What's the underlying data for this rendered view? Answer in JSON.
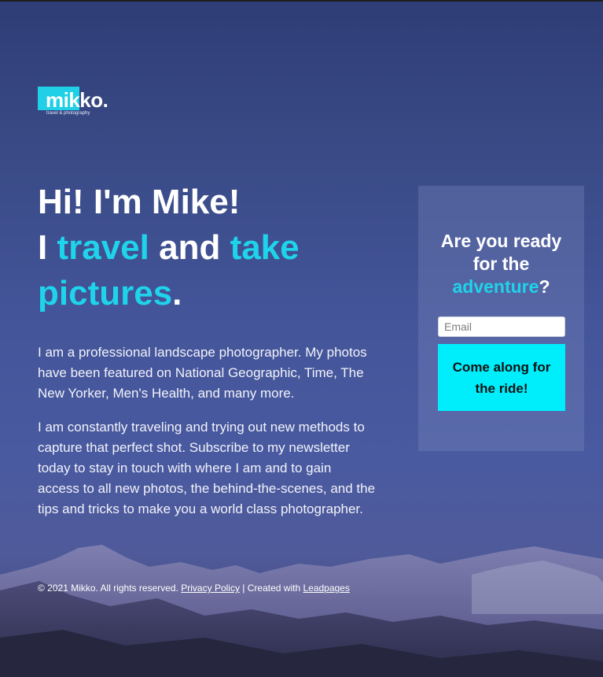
{
  "logo": {
    "name": "mikko.",
    "tagline": "travel & photography",
    "accent_color": "#1fd0e6"
  },
  "headline": {
    "line1": "Hi! I'm Mike!",
    "line2_prefix": "I ",
    "line2_word1": "travel",
    "line2_mid": " and ",
    "line2_word2": "take",
    "line3_word": "pictures",
    "line3_end": ".",
    "highlight_color": "#1fd3ea"
  },
  "bio": {
    "paragraph1": "I am a professional landscape photographer. My photos have been featured on National Geographic, Time, The New Yorker, Men's Health, and many more.",
    "paragraph2": "I am constantly traveling and trying out new methods to capture that perfect shot. Subscribe to my newsletter today to stay in touch with where I am and to gain access to all new photos, the behind-the-scenes, and the tips and tricks to make you a world class photographer."
  },
  "signup": {
    "title_line1": "Are you ready",
    "title_line2": "for the",
    "title_highlight": "adventure",
    "title_end": "?",
    "email_placeholder": "Email",
    "button_label": "Come along for the ride!",
    "button_color": "#00eefc"
  },
  "footer": {
    "copyright": "© 2021 Mikko. All rights reserved.",
    "privacy_link": "Privacy Policy",
    "separator": "| Created with",
    "leadpages_link": "Leadpages"
  }
}
